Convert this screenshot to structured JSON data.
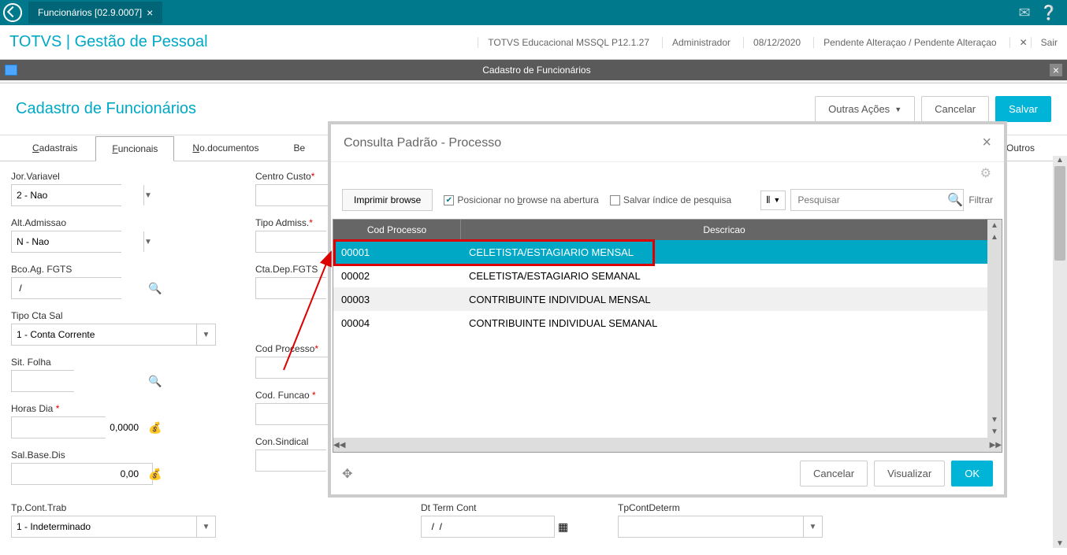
{
  "titleBar": {
    "tabLabel": "Funcionários [02.9.0007]"
  },
  "header": {
    "appTitle": "TOTVS | Gestão de Pessoal",
    "env": "TOTVS Educacional MSSQL P12.1.27",
    "user": "Administrador",
    "date": "08/12/2020",
    "status": "Pendente Alteraçao / Pendente Alteraçao",
    "exit": "Sair"
  },
  "windowTitle": "Cadastro de Funcionários",
  "pageTitle": "Cadastro de Funcionários",
  "actions": {
    "other": "Outras Ações",
    "cancel": "Cancelar",
    "save": "Salvar"
  },
  "tabs": {
    "cadastrais": "Cadastrais",
    "funcionais": "Funcionais",
    "documentos": "No.documentos",
    "beneficios": "Be",
    "outros": "Outros"
  },
  "form": {
    "jorVariavel": {
      "label": "Jor.Variavel",
      "value": "2 - Nao"
    },
    "altAdmissao": {
      "label": "Alt.Admissao",
      "value": "N - Nao"
    },
    "bcoAgFgts": {
      "label": "Bco.Ag. FGTS",
      "value": " /"
    },
    "tipoCtaSal": {
      "label": "Tipo Cta Sal",
      "value": "1 - Conta Corrente"
    },
    "sitFolha": {
      "label": "Sit. Folha",
      "value": ""
    },
    "horasDia": {
      "label": "Horas Dia",
      "req": " *",
      "value": "0,0000"
    },
    "salBaseDis": {
      "label": "Sal.Base.Dis",
      "value": "0,00"
    },
    "tpContTrab": {
      "label": "Tp.Cont.Trab",
      "value": "1 - Indeterminado"
    },
    "centroCusto": {
      "label": "Centro Custo",
      "req": "*",
      "value": ""
    },
    "tipoAdmiss": {
      "label": "Tipo Admiss.",
      "req": "*",
      "value": ""
    },
    "ctaDepFgts": {
      "label": "Cta.Dep.FGTS",
      "value": ""
    },
    "codProcesso": {
      "label": "Cod Processo",
      "req": "*",
      "value": ""
    },
    "codFuncao": {
      "label": "Cod. Funcao",
      "req": " *",
      "value": ""
    },
    "conSindical": {
      "label": "Con.Sindical",
      "value": ""
    },
    "dtTermCont": {
      "label": "Dt Term Cont",
      "value": "  /  /"
    },
    "tpContDeterm": {
      "label": "TpContDeterm",
      "value": ""
    }
  },
  "modal": {
    "title": "Consulta Padrão - Processo",
    "print": "Imprimir browse",
    "posicionar": "Posicionar no browse na abertura",
    "salvarIndice": "Salvar índice de pesquisa",
    "searchPlaceholder": "Pesquisar",
    "filter": "Filtrar",
    "col1": "Cod Processo",
    "col2": "Descricao",
    "rows": [
      {
        "cod": "00001",
        "desc": "CELETISTA/ESTAGIARIO MENSAL"
      },
      {
        "cod": "00002",
        "desc": "CELETISTA/ESTAGIARIO SEMANAL"
      },
      {
        "cod": "00003",
        "desc": "CONTRIBUINTE INDIVIDUAL MENSAL"
      },
      {
        "cod": "00004",
        "desc": "CONTRIBUINTE INDIVIDUAL SEMANAL"
      }
    ],
    "cancel": "Cancelar",
    "view": "Visualizar",
    "ok": "OK"
  }
}
